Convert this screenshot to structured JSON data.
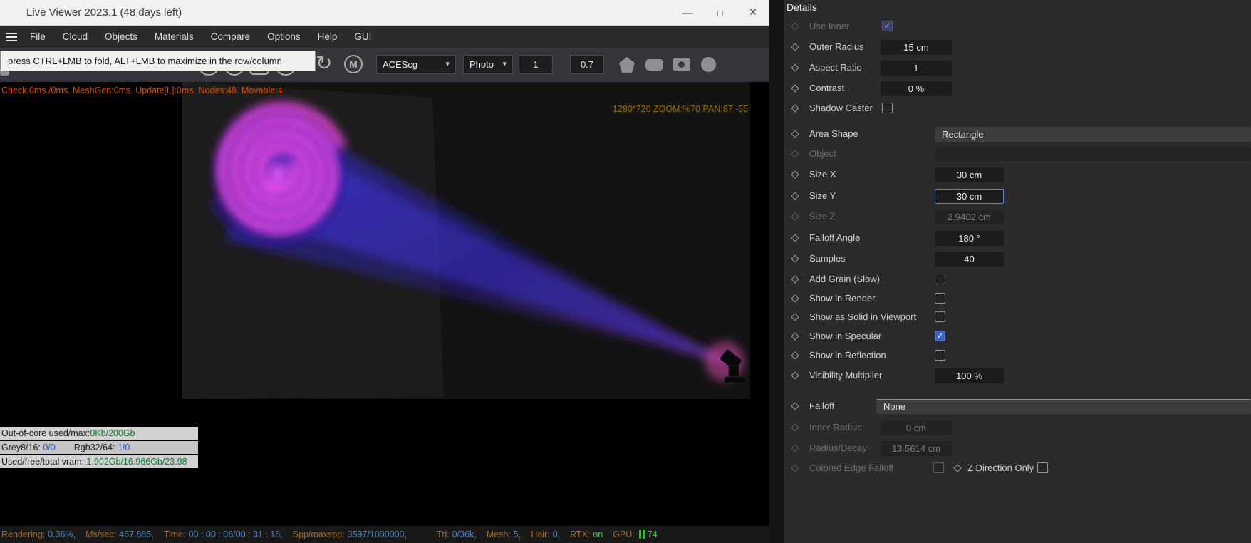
{
  "icons": {
    "check": "✓",
    "caret": "▾",
    "rotate": "↻",
    "m_badge": "M",
    "minimize": "—",
    "maximize": "□",
    "close": "×"
  },
  "titlebar": {
    "title": "Live Viewer 2023.1 (48 days left)"
  },
  "menubar": {
    "items": [
      "File",
      "Cloud",
      "Objects",
      "Materials",
      "Compare",
      "Options",
      "Help",
      "GUI"
    ]
  },
  "toolbar": {
    "tooltip": "press CTRL+LMB to fold, ALT+LMB to maximize in the row/column",
    "colorspace": "ACEScg",
    "response": "Photo",
    "field_1": "1",
    "field_2": "0.7"
  },
  "viewport": {
    "debug_text": "Check:0ms./0ms. MeshGen:0ms. Update[L]:0ms. Nodes:48. Movable:4",
    "resolution_text": "1280*720 ZOOM:%70 PAN:87,-55"
  },
  "memory_overlay": {
    "row1_label": "Out-of-core used/max:",
    "row1_value": "0Kb/200Gb",
    "row2_label1": "Grey8/16:",
    "row2_value1": "0/0",
    "row2_label2": "Rgb32/64:",
    "row2_value2": "1/0",
    "row3_label": "Used/free/total vram:",
    "row3_value": "1.902Gb/16.966Gb/23.98"
  },
  "statusbar": {
    "rendering_label": "Rendering:",
    "rendering_value": "0.36%,",
    "mssec_label": "Ms/sec:",
    "mssec_value": "467.885,",
    "time_label": "Time:",
    "time_value": "00 : 00 : 06/00 : 31 : 18,",
    "spp_label": "Spp/maxspp:",
    "spp_value": "3597/1000000,",
    "tri_label": "Tri:",
    "tri_value": "0/36k,",
    "mesh_label": "Mesh:",
    "mesh_value": "5,",
    "hair_label": "Hair:",
    "hair_value": "0,",
    "rtx_label": "RTX:",
    "rtx_value": "on",
    "gpu_label": "GPU:",
    "gpu_value": "74"
  },
  "details": {
    "title": "Details",
    "rows": [
      {
        "label": "Use Inner",
        "type": "checkbox",
        "checked": true,
        "disabled": true
      },
      {
        "label": "Outer Radius",
        "type": "field",
        "value": "15 cm"
      },
      {
        "label": "Aspect Ratio",
        "type": "field",
        "value": "1"
      },
      {
        "label": "Contrast",
        "type": "field",
        "value": "0 %"
      },
      {
        "label": "Shadow Caster",
        "type": "checkbox",
        "checked": false
      },
      {
        "label": "Area Shape",
        "type": "dropdown",
        "value": "Rectangle"
      },
      {
        "label": "Object",
        "type": "objectlink",
        "value": "",
        "disabled": true
      },
      {
        "label": "Size X",
        "type": "field",
        "value": "30 cm"
      },
      {
        "label": "Size Y",
        "type": "field",
        "value": "30 cm",
        "focused": true
      },
      {
        "label": "Size Z",
        "type": "field",
        "value": "2.9402 cm",
        "disabled": true
      },
      {
        "label": "Falloff Angle",
        "type": "field",
        "value": "180 °"
      },
      {
        "label": "Samples",
        "type": "field",
        "value": "40"
      },
      {
        "label": "Add Grain (Slow)",
        "type": "checkbox",
        "checked": false
      },
      {
        "label": "Show in Render",
        "type": "checkbox",
        "checked": false
      },
      {
        "label": "Show as Solid in Viewport",
        "type": "checkbox",
        "checked": false
      },
      {
        "label": "Show in Specular",
        "type": "checkbox",
        "checked": true
      },
      {
        "label": "Show in Reflection",
        "type": "checkbox",
        "checked": false
      },
      {
        "label": "Visibility Multiplier",
        "type": "field",
        "value": "100 %"
      },
      {
        "label": "Falloff",
        "type": "dropdown",
        "value": "None"
      },
      {
        "label": "Inner Radius",
        "type": "field",
        "value": "0 cm",
        "disabled": true
      },
      {
        "label": "Radius/Decay",
        "type": "field",
        "value": "13.5614 cm",
        "disabled": true
      },
      {
        "label": "Colored Edge Falloff",
        "type": "checkbox",
        "checked": false,
        "disabled": true
      },
      {
        "label": "Z Direction Only",
        "type": "checkbox",
        "checked": false
      }
    ]
  },
  "colors": {
    "accent_blue": "#3e68c8",
    "focus_border": "#5b87d8",
    "status_label_orange": "#b06a1e",
    "status_value_blue": "#4f86c6",
    "status_green": "#3dc83d",
    "debug_orange": "#d2500a",
    "beam_blue": "#3c2cf0",
    "gobo_magenta": "#ff4ff2"
  }
}
